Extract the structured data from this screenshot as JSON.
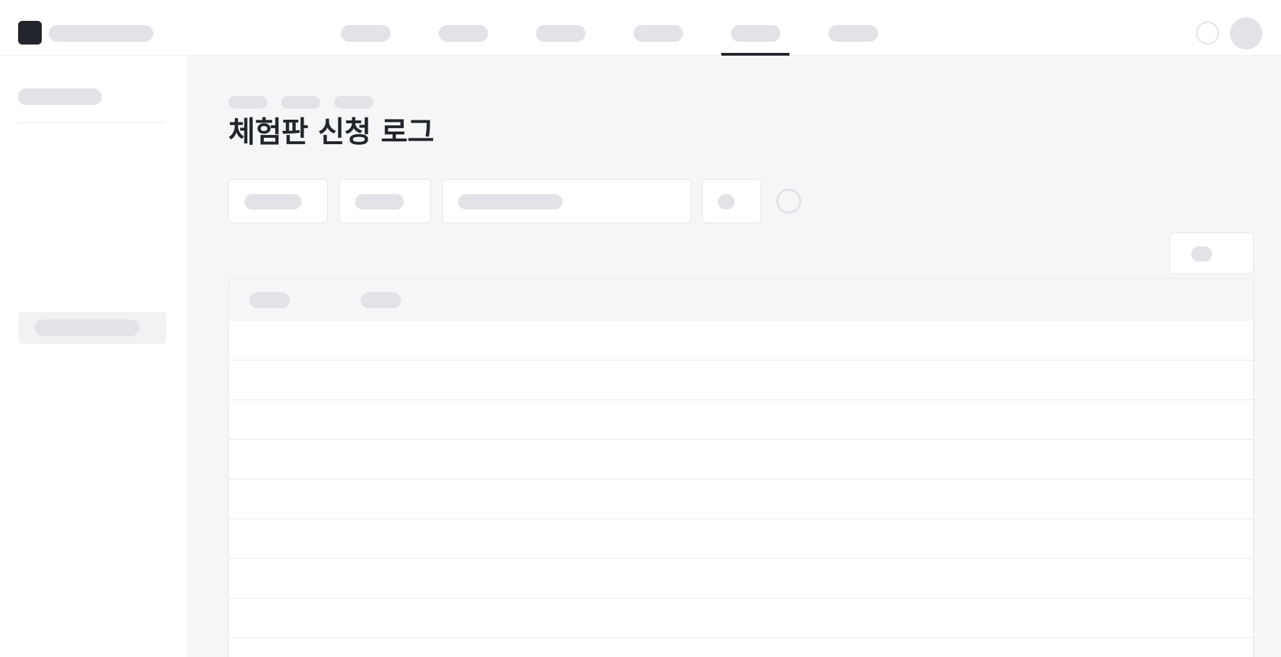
{
  "page": {
    "title": "체험판 신청 로그"
  },
  "header": {
    "nav_items": [
      "",
      "",
      "",
      "",
      "",
      ""
    ],
    "active_nav_index": 4
  },
  "table": {
    "row_count": 8
  },
  "colors": {
    "text_primary": "#22252b",
    "skeleton": "#e1e3e7",
    "main_bg": "#f5f6f8",
    "active_indicator": "#22252b"
  },
  "icons": {
    "logo": "app-logo-icon",
    "notification": "notification-icon",
    "refresh": "refresh-icon",
    "avatar": "user-avatar"
  }
}
